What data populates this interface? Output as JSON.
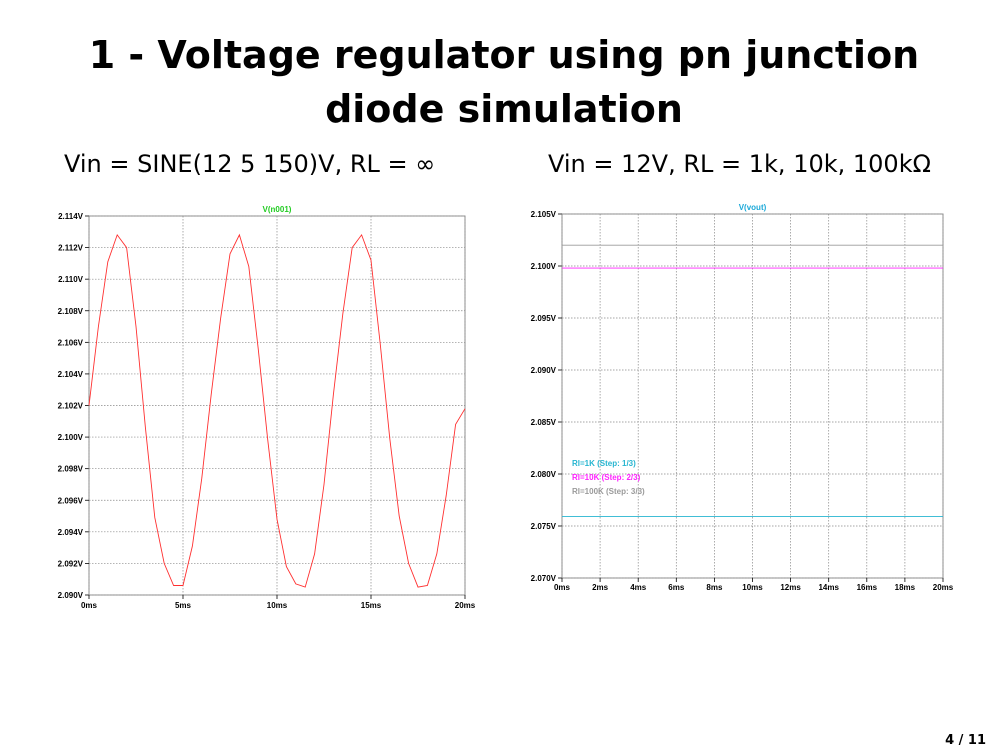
{
  "slide": {
    "title": "1 - Voltage regulator using pn junction diode simulation",
    "caption_left": "Vin = SINE(12 5 150)V, RL = ∞",
    "caption_right": "Vin = 12V, RL = 1k, 10k, 100kΩ",
    "page_number": "4 / 11"
  },
  "chart_data": [
    {
      "type": "line",
      "title": "V(n001)",
      "title_color": "#22cc22",
      "xlabel": "",
      "ylabel": "",
      "xlim": [
        0,
        20
      ],
      "ylim": [
        2.09,
        2.114
      ],
      "x_ticks": [
        0,
        5,
        10,
        15,
        20
      ],
      "x_tick_labels": [
        "0ms",
        "5ms",
        "10ms",
        "15ms",
        "20ms"
      ],
      "y_ticks": [
        2.09,
        2.092,
        2.094,
        2.096,
        2.098,
        2.1,
        2.102,
        2.104,
        2.106,
        2.108,
        2.11,
        2.112,
        2.114
      ],
      "y_tick_labels": [
        "2.090V",
        "2.092V",
        "2.094V",
        "2.096V",
        "2.098V",
        "2.100V",
        "2.102V",
        "2.104V",
        "2.106V",
        "2.108V",
        "2.110V",
        "2.112V",
        "2.114V"
      ],
      "grid": true,
      "series": [
        {
          "color": "#ff3030",
          "x": [
            0,
            0.5,
            1.0,
            1.5,
            2.0,
            2.5,
            3.0,
            3.5,
            4.0,
            4.5,
            5.0,
            5.5,
            6.0,
            6.5,
            7.0,
            7.5,
            8.0,
            8.5,
            9.0,
            9.5,
            10.0,
            10.5,
            11.0,
            11.5,
            12.0,
            12.5,
            13.0,
            13.5,
            14.0,
            14.5,
            15.0,
            15.5,
            16.0,
            16.5,
            17.0,
            17.5,
            18.0,
            18.5,
            19.0,
            19.5,
            20.0
          ],
          "values": [
            2.102,
            2.107,
            2.1111,
            2.1128,
            2.112,
            2.107,
            2.1006,
            2.0949,
            2.092,
            2.0906,
            2.0906,
            2.0931,
            2.0974,
            2.1027,
            2.1075,
            2.1116,
            2.1128,
            2.1108,
            2.1056,
            2.0999,
            2.0948,
            2.0918,
            2.0907,
            2.0905,
            2.0926,
            2.097,
            2.1027,
            2.1078,
            2.112,
            2.1128,
            2.1112,
            2.1058,
            2.0999,
            2.095,
            2.092,
            2.0905,
            2.0906,
            2.0926,
            2.0963,
            2.1008,
            2.1018
          ]
        }
      ]
    },
    {
      "type": "line",
      "title": "V(vout)",
      "title_color": "#1aa8d8",
      "xlabel": "",
      "ylabel": "",
      "xlim": [
        0,
        20
      ],
      "ylim": [
        2.07,
        2.105
      ],
      "x_ticks": [
        0,
        2,
        4,
        6,
        8,
        10,
        12,
        14,
        16,
        18,
        20
      ],
      "x_tick_labels": [
        "0ms",
        "2ms",
        "4ms",
        "6ms",
        "8ms",
        "10ms",
        "12ms",
        "14ms",
        "16ms",
        "18ms",
        "20ms"
      ],
      "y_ticks": [
        2.07,
        2.075,
        2.08,
        2.085,
        2.09,
        2.095,
        2.1,
        2.105
      ],
      "y_tick_labels": [
        "2.070V",
        "2.075V",
        "2.080V",
        "2.085V",
        "2.090V",
        "2.095V",
        "2.100V",
        "2.105V"
      ],
      "grid": true,
      "legend": "bottom-left",
      "series": [
        {
          "name": "Rl=1K  (Step: 1/3)",
          "color": "#26b5d0",
          "x": [
            0,
            20
          ],
          "values": [
            2.0759,
            2.0759
          ]
        },
        {
          "name": "Rl=10K  (Step: 2/3)",
          "color": "#ff22ff",
          "x": [
            0,
            20
          ],
          "values": [
            2.0998,
            2.0998
          ]
        },
        {
          "name": "Rl=100K  (Step: 3/3)",
          "color": "#9a9a9a",
          "x": [
            0,
            20
          ],
          "values": [
            2.102,
            2.102
          ]
        }
      ]
    }
  ]
}
